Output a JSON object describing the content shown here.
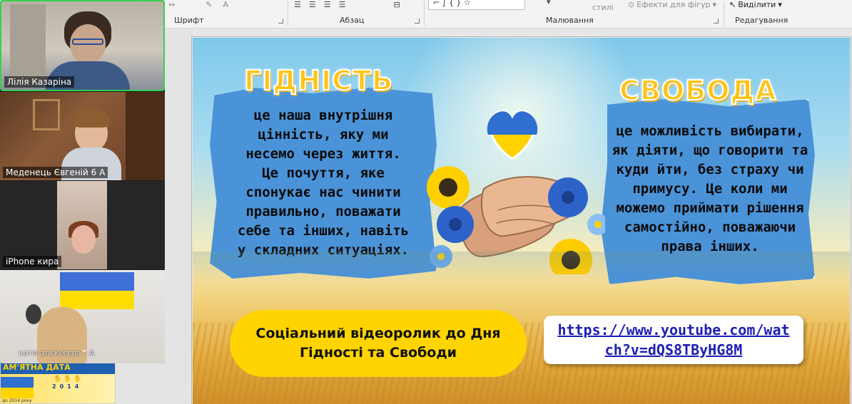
{
  "ribbon": {
    "groups": [
      {
        "label": "Шрифт"
      },
      {
        "label": "Абзац"
      },
      {
        "label": "Малювання"
      },
      {
        "label": "Редагування"
      }
    ],
    "styles_label": "стилі",
    "shape_effects_label": "Ефекти для фігур",
    "select_label": "Виділити"
  },
  "participants": [
    {
      "name": "Лілія Казаріна"
    },
    {
      "name": "Меденець Євгеній 6 А"
    },
    {
      "name": "iPhone кира"
    },
    {
      "name": "катя алєксєєва - А"
    }
  ],
  "thumbnail": {
    "banner": "АМ'ЯТНА ДАТА",
    "year": "2014",
    "caption": "до 2014 року"
  },
  "slide": {
    "left_heading": "ГІДНІСТЬ",
    "left_text": "це наша внутрішня\nцінність, яку ми\nнесемо через життя.\nЦе почуття, яке\nспонукає нас чинити\nправильно, поважати\nсебе та інших, навіть\nу складних ситуаціях.",
    "right_heading": "СВОБОДА",
    "right_text": "це можливість вибирати,\nяк діяти, що говорити та\nкуди йти, без страху чи\nпримусу. Це коли ми\nможемо приймати рішення\nсамостійно, поважаючи\nправа інших.",
    "caption": "Соціальний відеоролик до Дня\nГідності та Свободи",
    "link": "https://www.youtube.com/wat\nch?v=dQS8TByHG8M"
  },
  "colors": {
    "panel_blue": "#4b93d8",
    "heading_yellow": "#ffc317",
    "pill_yellow": "#ffd400",
    "link_blue": "#1e1eb4",
    "active_speaker": "#35d14e"
  }
}
